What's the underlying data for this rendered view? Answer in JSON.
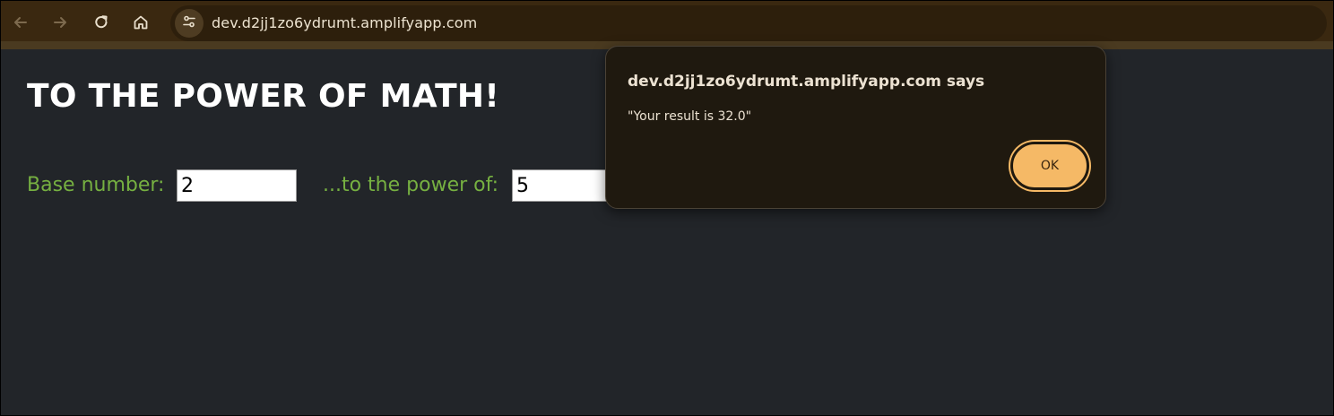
{
  "browser": {
    "url": "dev.d2jj1zo6ydrumt.amplifyapp.com",
    "icons": {
      "back": "back-arrow-icon",
      "forward": "forward-arrow-icon",
      "reload": "reload-icon",
      "home": "home-icon",
      "site_info": "site-settings-icon"
    },
    "colors": {
      "toolbar": "#3a2810",
      "omnibox": "#2d1f0c"
    }
  },
  "page": {
    "title": "TO THE POWER OF MATH!",
    "base_label": "Base number:",
    "base_value": "2",
    "power_label": "...to the power of:",
    "power_value": "5",
    "colors": {
      "background": "#222529",
      "label": "#76b041",
      "title": "#ffffff"
    }
  },
  "dialog": {
    "title": "dev.d2jj1zo6ydrumt.amplifyapp.com says",
    "message": "\"Your result is 32.0\"",
    "ok_label": "OK",
    "colors": {
      "background": "#1f190f",
      "button": "#f5b966"
    }
  }
}
